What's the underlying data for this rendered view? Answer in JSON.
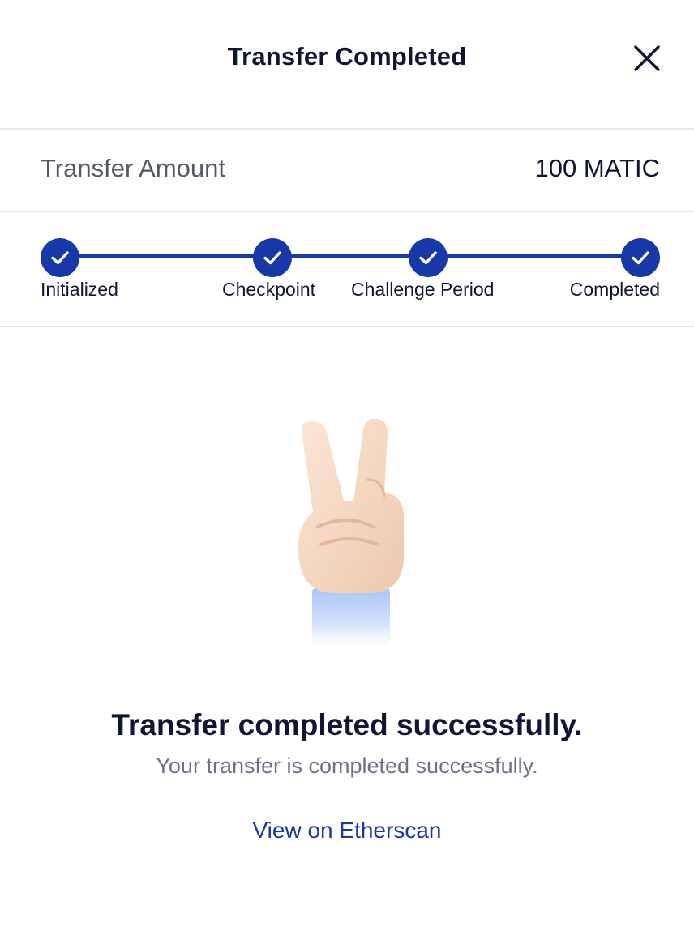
{
  "header": {
    "title": "Transfer Completed",
    "close_icon": "close-icon"
  },
  "amount": {
    "label": "Transfer Amount",
    "value": "100 MATIC"
  },
  "steps": [
    {
      "label": "Initialized",
      "status": "done"
    },
    {
      "label": "Checkpoint",
      "status": "done"
    },
    {
      "label": "Challenge Period",
      "status": "done"
    },
    {
      "label": "Completed",
      "status": "done"
    }
  ],
  "illustration": "peace-hand-icon",
  "result": {
    "headline": "Transfer completed successfully.",
    "message": "Your transfer is completed successfully.",
    "link_label": "View on Etherscan"
  },
  "colors": {
    "accent": "#1837a8",
    "text": "#0f1633",
    "muted": "#6b7185"
  }
}
